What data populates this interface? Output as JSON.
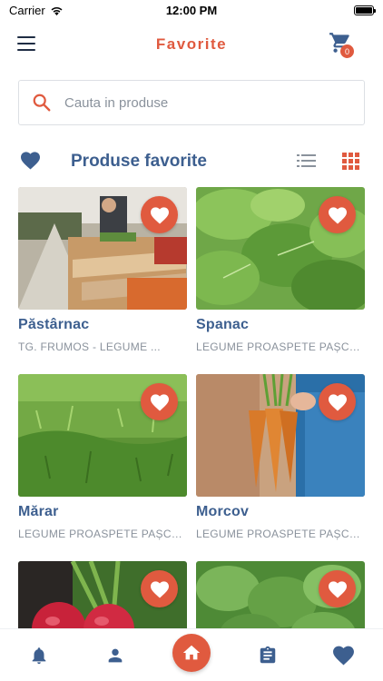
{
  "status_bar": {
    "carrier": "Carrier",
    "time": "12:00 PM"
  },
  "header": {
    "title": "Favorite",
    "cart_count": "0"
  },
  "search": {
    "placeholder": "Cauta in produse"
  },
  "section": {
    "title": "Produse favorite"
  },
  "products": [
    {
      "name": "Păstârnac",
      "vendor": "TG. FRUMOS - LEGUME ..."
    },
    {
      "name": "Spanac",
      "vendor": "LEGUME PROASPETE PAȘCANI"
    },
    {
      "name": "Mărar",
      "vendor": "LEGUME PROASPETE PAȘCANI"
    },
    {
      "name": "Morcov",
      "vendor": "LEGUME PROASPETE PAȘCANI"
    },
    {
      "name": "",
      "vendor": ""
    },
    {
      "name": "",
      "vendor": ""
    }
  ],
  "colors": {
    "accent": "#e05a3f",
    "primary": "#3d5f8f",
    "muted": "#8a929c"
  },
  "icons": {
    "menu": "hamburger-menu-icon",
    "cart": "cart-icon",
    "search": "search-icon",
    "favorite": "heart-icon",
    "list_view": "list-view-icon",
    "grid_view": "grid-view-icon",
    "notifications": "bell-icon",
    "profile": "person-icon",
    "home": "home-icon",
    "orders": "clipboard-icon"
  }
}
